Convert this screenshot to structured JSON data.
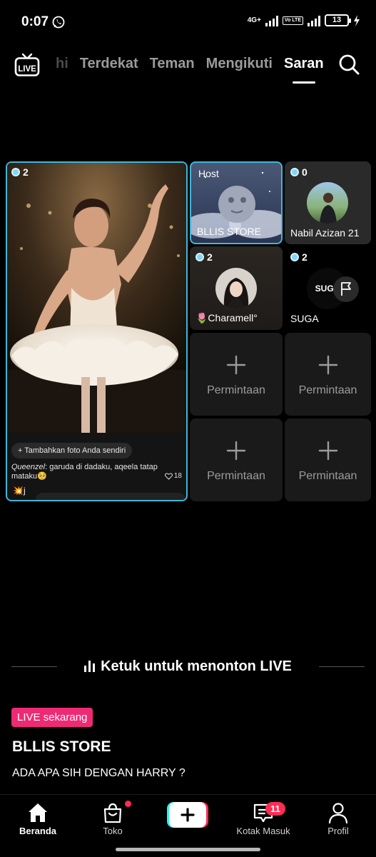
{
  "status_bar": {
    "time": "0:07",
    "network": "4G+",
    "volte": "Vo LTE",
    "battery": "13"
  },
  "top_nav": {
    "tabs": [
      {
        "label": "hi"
      },
      {
        "label": "Terdekat"
      },
      {
        "label": "Teman"
      },
      {
        "label": "Mengikuti"
      },
      {
        "label": "Saran"
      }
    ],
    "active_tab": "Saran",
    "live_icon_text": "LIVE"
  },
  "grid": {
    "main_card": {
      "viewers": "2",
      "add_photo_label": "+ Tambahkan foto Anda sendiri",
      "comment_user": "Queenzel",
      "comment_text": ": garuda di dadaku, aqeela tatap mataku🥺",
      "likes": "18",
      "emoji_line": "💥j"
    },
    "tiles": [
      {
        "top_label": "Host",
        "name": "BLLIS STORE"
      },
      {
        "viewers": "0",
        "name": "Nabil Azizan 21"
      },
      {
        "viewers": "2",
        "name": "🌷Charamell°"
      },
      {
        "viewers": "2",
        "name": "SUGA",
        "avatar_text": "SUGA"
      }
    ],
    "empty_label": "Permintaan"
  },
  "bottom_info": {
    "watch_prompt": "Ketuk untuk menonton LIVE",
    "live_badge": "LIVE sekarang",
    "streamer": "BLLIS STORE",
    "title": "ADA APA SIH DENGAN HARRY ?"
  },
  "bottom_nav": {
    "items": [
      {
        "label": "Beranda",
        "icon": "home-icon"
      },
      {
        "label": "Toko",
        "icon": "shop-bag-icon"
      },
      {
        "label": "",
        "icon": "create-icon"
      },
      {
        "label": "Kotak Masuk",
        "icon": "inbox-icon"
      },
      {
        "label": "Profil",
        "icon": "profile-icon"
      }
    ],
    "inbox_count": "11"
  },
  "colors": {
    "accent_border": "#3fb6d8",
    "live_badge": "#ee2a74",
    "notification": "#fe2c55"
  }
}
